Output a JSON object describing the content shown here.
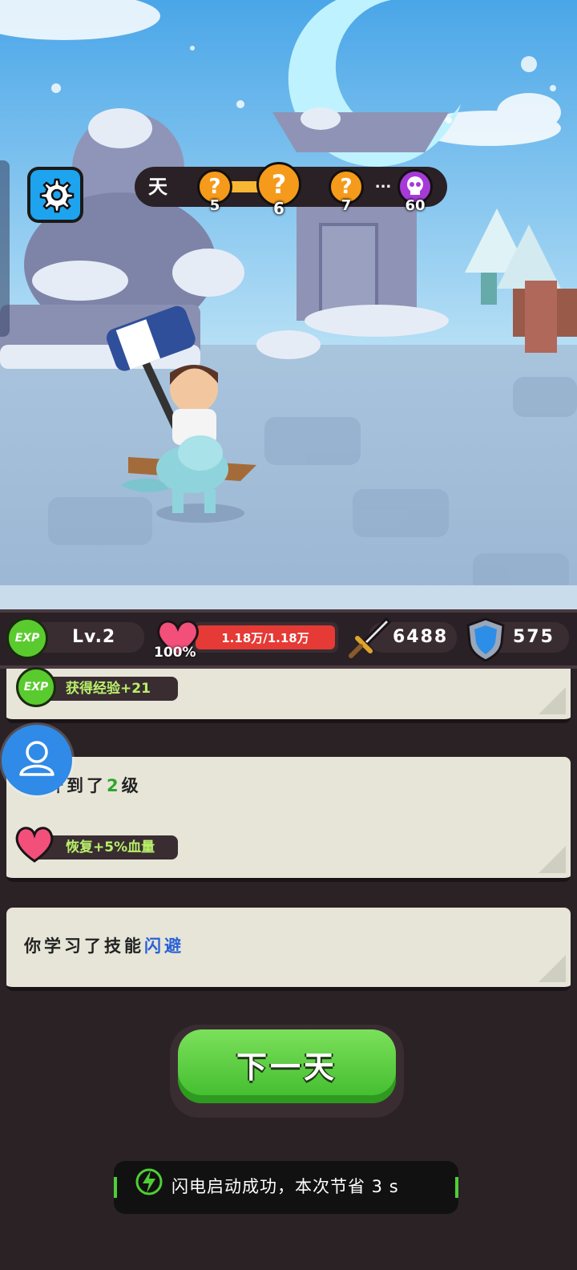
{
  "progress": {
    "day_label": "天",
    "stages": [
      {
        "icon": "question-mark-icon",
        "number": "5"
      },
      {
        "icon": "question-mark-icon",
        "number": "6"
      },
      {
        "icon": "question-mark-icon",
        "number": "7"
      },
      {
        "icon": "ellipsis-icon",
        "number": "..."
      },
      {
        "icon": "skull-boss-icon",
        "number": "60"
      }
    ]
  },
  "hud": {
    "exp_icon": "EXP",
    "level": "Lv.2",
    "hp_percent": "100%",
    "hp_value": "1.18万/1.18万",
    "attack": "6488",
    "defense": "575"
  },
  "log": {
    "card1": {
      "reward_icon": "EXP",
      "reward": "获得经验+21"
    },
    "card2": {
      "level_prefix": "升到了",
      "level_number": "2",
      "level_suffix": "级",
      "reward": "恢复+5%血量"
    },
    "card3": {
      "text": "你学习了技能",
      "skill": "闪避"
    }
  },
  "next_button": {
    "label": "下一天"
  },
  "toast": {
    "text": "闪电启动成功，本次节省 3 s"
  },
  "colors": {
    "accent_green": "#4fcf35",
    "skill_blue": "#2a62d6",
    "level_green": "#2fa52a",
    "hp_red": "#e53a35"
  }
}
